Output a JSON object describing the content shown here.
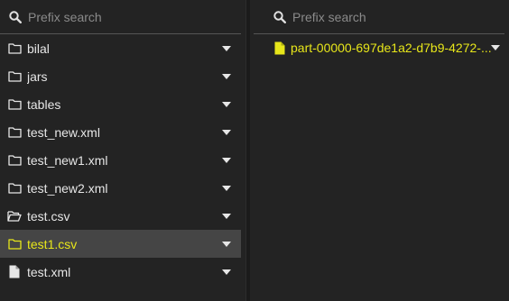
{
  "left_pane": {
    "search_placeholder": "Prefix search",
    "items": [
      {
        "label": "bilal",
        "icon": "folder-icon"
      },
      {
        "label": "jars",
        "icon": "folder-icon"
      },
      {
        "label": "tables",
        "icon": "folder-icon"
      },
      {
        "label": "test_new.xml",
        "icon": "folder-icon"
      },
      {
        "label": "test_new1.xml",
        "icon": "folder-icon"
      },
      {
        "label": "test_new2.xml",
        "icon": "folder-icon"
      },
      {
        "label": "test.csv",
        "icon": "folder-open-icon"
      },
      {
        "label": "test1.csv",
        "icon": "folder-icon",
        "selected": true
      },
      {
        "label": "test.xml",
        "icon": "file-icon"
      }
    ]
  },
  "right_pane": {
    "search_placeholder": "Prefix search",
    "items": [
      {
        "label": "part-00000-697de1a2-d7b9-4272-...",
        "icon": "file-icon"
      }
    ]
  },
  "colors": {
    "background": "#232323",
    "selected_row": "#454545",
    "highlight": "#e7e61a",
    "text": "#e6e6e6",
    "placeholder": "#8a8a8a"
  }
}
